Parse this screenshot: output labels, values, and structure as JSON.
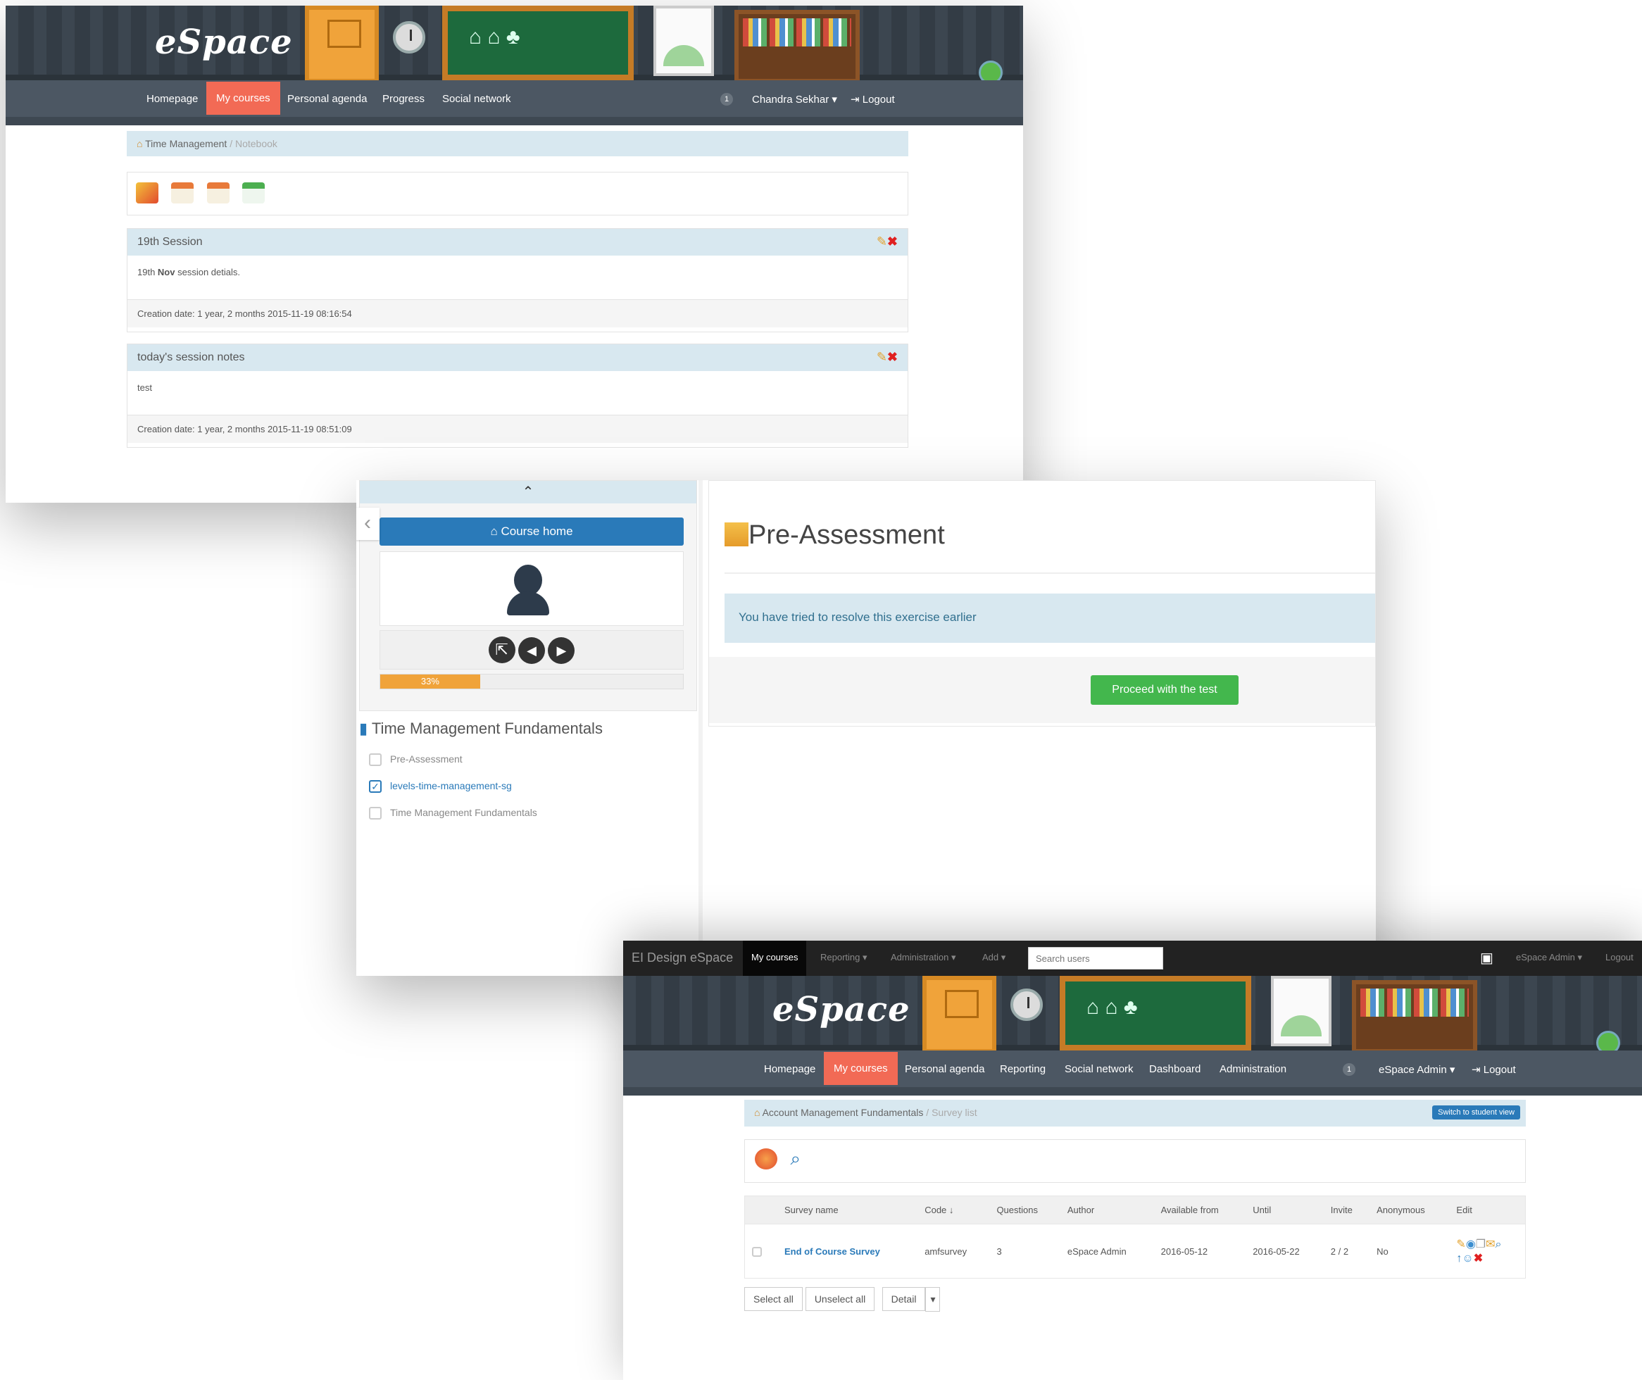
{
  "window1": {
    "logo": "eSpace",
    "nav": [
      "Homepage",
      "My courses",
      "Personal agenda",
      "Progress",
      "Social network"
    ],
    "active_nav": "My courses",
    "user_count": "1",
    "user": "Chandra Sekhar",
    "logout": "Logout",
    "breadcrumb": {
      "home": "Time Management",
      "current": "Notebook"
    },
    "notes": [
      {
        "title": "19th Session",
        "body_prefix": "19th ",
        "body_bold": "Nov",
        "body_suffix": " session detials.",
        "footer": "Creation date: 1 year, 2 months 2015-11-19 08:16:54"
      },
      {
        "title": "today's session notes",
        "body": "test",
        "footer": "Creation date: 1 year, 2 months 2015-11-19 08:51:09"
      }
    ]
  },
  "window2": {
    "course_home": "Course home",
    "progress_label": "33%",
    "progress": 0.33,
    "course_title": "Time Management Fundamentals",
    "items": [
      {
        "label": "Pre-Assessment",
        "checked": false
      },
      {
        "label": "levels-time-management-sg",
        "checked": true
      },
      {
        "label": "Time Management Fundamentals",
        "checked": false
      }
    ],
    "exercise_title": "Pre-Assessment",
    "alert": "You have tried to resolve this exercise earlier",
    "proceed": "Proceed with the test"
  },
  "window3": {
    "top_brand": "EI Design eSpace",
    "top_nav": [
      "My courses",
      "Reporting",
      "Administration",
      "Add"
    ],
    "search_placeholder": "Search users",
    "admin_menu": "eSpace Admin",
    "top_logout": "Logout",
    "logo": "eSpace",
    "nav": [
      "Homepage",
      "My courses",
      "Personal agenda",
      "Reporting",
      "Social network",
      "Dashboard",
      "Administration"
    ],
    "user_count": "1",
    "user": "eSpace Admin",
    "logout": "Logout",
    "breadcrumb": {
      "home": "Account Management Fundamentals",
      "current": "Survey list"
    },
    "switch_btn": "Switch to student view",
    "columns": [
      "Survey name",
      "Code",
      "Questions",
      "Author",
      "Available from",
      "Until",
      "Invite",
      "Anonymous",
      "Edit"
    ],
    "row": {
      "name": "End of Course Survey",
      "code": "amfsurvey",
      "questions": "3",
      "author": "eSpace Admin",
      "from": "2016-05-12",
      "until": "2016-05-22",
      "invite": "2 / 2",
      "anonymous": "No"
    },
    "select_all": "Select all",
    "unselect_all": "Unselect all",
    "detail": "Detail"
  },
  "colors": {
    "nav_active": "#f26a55",
    "primary": "#2a7ab9",
    "success": "#43b74d",
    "progress": "#f0a33a",
    "info_bg": "#d8e8f0"
  }
}
